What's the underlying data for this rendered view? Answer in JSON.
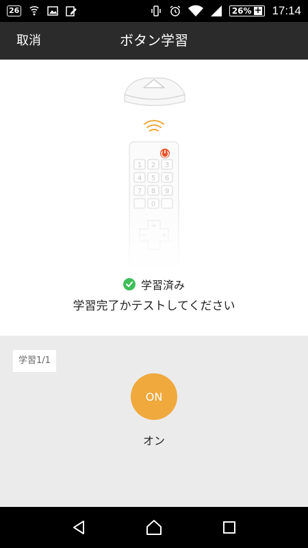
{
  "status_bar": {
    "notification_badge": "26",
    "battery_percent": "26%",
    "battery_plus": "+",
    "time": "17:14"
  },
  "app_bar": {
    "cancel_label": "取消",
    "title": "ボタン学習"
  },
  "learning": {
    "status_text": "学習済み",
    "instruction": "学習完了かテストしてください"
  },
  "panel": {
    "chip_label": "学習1/1",
    "on_button_label": "ON",
    "on_caption": "オン",
    "button_color": "#f0a93d"
  },
  "remote_keys": [
    "1",
    "2",
    "3",
    "4",
    "5",
    "6",
    "7",
    "8",
    "9",
    "",
    "0",
    ""
  ],
  "colors": {
    "app_bar": "#2b2b2b",
    "success": "#3fbe5b",
    "power": "#e8542b",
    "signal": "#f0a93d"
  }
}
